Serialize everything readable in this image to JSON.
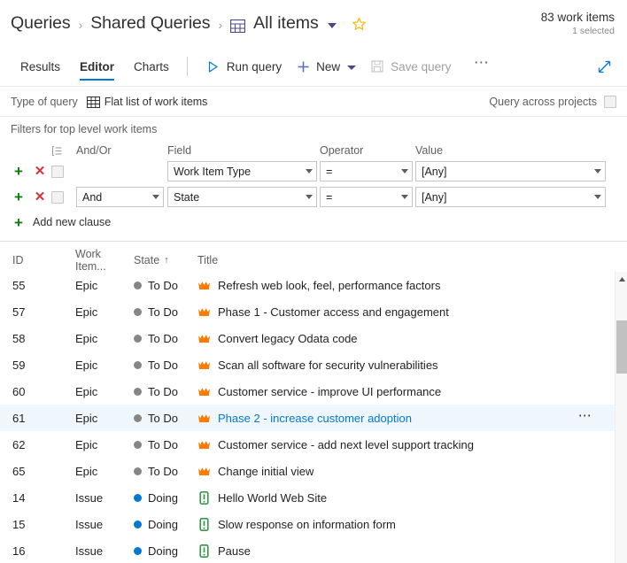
{
  "breadcrumb": {
    "root": "Queries",
    "folder": "Shared Queries",
    "current": "All items",
    "separator": "›",
    "grid_icon": "table-grid-icon",
    "chevron_icon": "chevron-down-icon",
    "star_icon": "favorite-star-icon"
  },
  "counts": {
    "work_items": "83 work items",
    "selected": "1 selected"
  },
  "tabs": [
    {
      "label": "Results",
      "active": false
    },
    {
      "label": "Editor",
      "active": true
    },
    {
      "label": "Charts",
      "active": false
    }
  ],
  "commands": {
    "run_query": "Run query",
    "run_icon": "play-triangle-icon",
    "new": "New",
    "new_icon": "plus-icon",
    "save_query": "Save query",
    "save_icon": "save-floppy-icon",
    "save_disabled": true,
    "overflow": "…",
    "overflow_icon": "more-ellipsis-icon",
    "expand_icon": "expand-diagonal-icon"
  },
  "query_type": {
    "label": "Type of query",
    "value": "Flat list of work items",
    "icon": "flat-list-grid-icon",
    "across_projects_label": "Query across projects",
    "across_projects_checked": false
  },
  "filters": {
    "section_label": "Filters for top level work items",
    "group_icon": "group-clauses-icon",
    "headers": {
      "andor": "And/Or",
      "field": "Field",
      "operator": "Operator",
      "value": "Value"
    },
    "clauses": [
      {
        "andor": "",
        "field": "Work Item Type",
        "operator": "=",
        "value": "[Any]",
        "checked": false,
        "show_andor": false
      },
      {
        "andor": "And",
        "field": "State",
        "operator": "=",
        "value": "[Any]",
        "checked": false,
        "show_andor": true
      }
    ],
    "add_clause": "Add new clause",
    "add_icon": "plus-icon",
    "remove_icon": "remove-x-icon"
  },
  "results": {
    "headers": {
      "id": "ID",
      "work_item_type": "Work Item...",
      "state": "State",
      "state_sort": "↑",
      "title": "Title"
    },
    "rows": [
      {
        "id": "55",
        "type": "Epic",
        "state": "To Do",
        "title": "Refresh web look, feel, performance factors",
        "icon": "epic-crown-icon",
        "selected": false
      },
      {
        "id": "57",
        "type": "Epic",
        "state": "To Do",
        "title": "Phase 1 - Customer access and engagement",
        "icon": "epic-crown-icon",
        "selected": false
      },
      {
        "id": "58",
        "type": "Epic",
        "state": "To Do",
        "title": "Convert legacy Odata code",
        "icon": "epic-crown-icon",
        "selected": false
      },
      {
        "id": "59",
        "type": "Epic",
        "state": "To Do",
        "title": "Scan all software for security vulnerabilities",
        "icon": "epic-crown-icon",
        "selected": false
      },
      {
        "id": "60",
        "type": "Epic",
        "state": "To Do",
        "title": "Customer service - improve UI performance",
        "icon": "epic-crown-icon",
        "selected": false
      },
      {
        "id": "61",
        "type": "Epic",
        "state": "To Do",
        "title": "Phase 2 - increase customer adoption",
        "icon": "epic-crown-icon",
        "selected": true
      },
      {
        "id": "62",
        "type": "Epic",
        "state": "To Do",
        "title": "Customer service - add next level support tracking",
        "icon": "epic-crown-icon",
        "selected": false
      },
      {
        "id": "65",
        "type": "Epic",
        "state": "To Do",
        "title": "Change initial view",
        "icon": "epic-crown-icon",
        "selected": false
      },
      {
        "id": "14",
        "type": "Issue",
        "state": "Doing",
        "title": "Hello World Web Site",
        "icon": "issue-book-icon",
        "selected": false
      },
      {
        "id": "15",
        "type": "Issue",
        "state": "Doing",
        "title": "Slow response on information form",
        "icon": "issue-book-icon",
        "selected": false
      },
      {
        "id": "16",
        "type": "Issue",
        "state": "Doing",
        "title": "Pause",
        "icon": "issue-book-icon",
        "selected": false
      }
    ],
    "row_menu_icon": "more-ellipsis-icon",
    "scroll_up_icon": "scroll-up-arrow-icon"
  },
  "colors": {
    "accent": "#0078d4",
    "epic_orange": "#ff7b00",
    "issue_green": "#339947",
    "state_todo_gray": "#868686",
    "state_doing_blue": "#0078d4",
    "add_green": "#107c10",
    "remove_red": "#d13438",
    "selected_row_bg": "#eff6fc",
    "star_gold": "#ffb900"
  }
}
